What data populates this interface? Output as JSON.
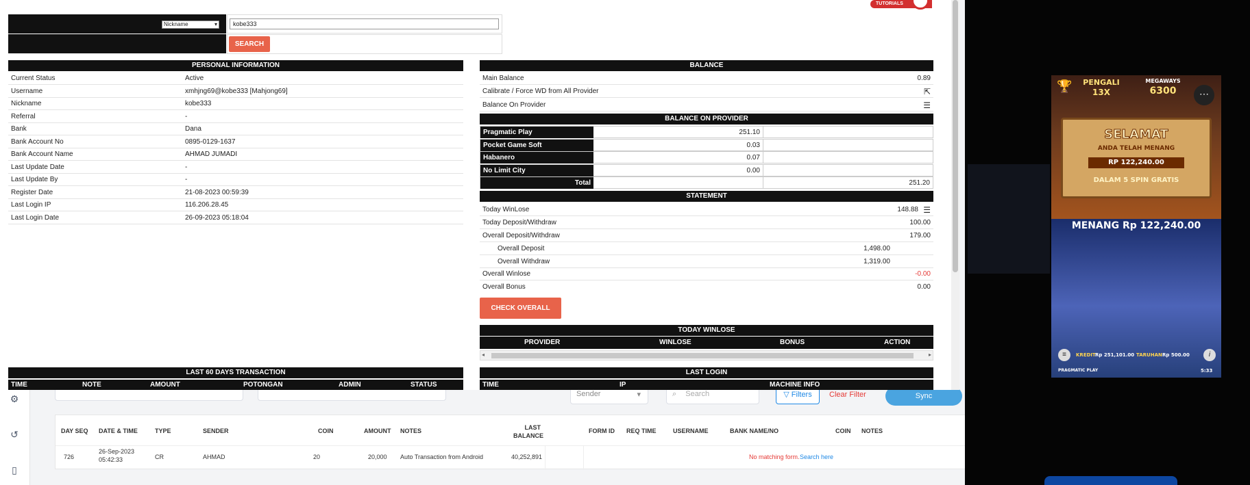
{
  "search": {
    "type_value": "Nickname",
    "query": "kobe333",
    "button": "SEARCH",
    "tutorials": "TUTORIALS"
  },
  "personal": {
    "title": "PERSONAL INFORMATION",
    "rows": [
      {
        "label": "Current Status",
        "value": "Active"
      },
      {
        "label": "Username",
        "value": "xmhjng69@kobe333  [Mahjong69]"
      },
      {
        "label": "Nickname",
        "value": "kobe333"
      },
      {
        "label": "Referral",
        "value": "-"
      },
      {
        "label": "Bank",
        "value": "Dana"
      },
      {
        "label": "Bank Account No",
        "value": "0895-0129-1637"
      },
      {
        "label": "Bank Account Name",
        "value": "AHMAD JUMADI"
      },
      {
        "label": "Last Update Date",
        "value": "-"
      },
      {
        "label": "Last Update By",
        "value": "-"
      },
      {
        "label": "Register Date",
        "value": "21-08-2023 00:59:39"
      },
      {
        "label": "Last Login IP",
        "value": "116.206.28.45"
      },
      {
        "label": "Last Login Date",
        "value": "26-09-2023 05:18:04"
      }
    ]
  },
  "balance": {
    "title": "BALANCE",
    "main_label": "Main Balance",
    "main_value": "0.89",
    "calibrate_label": "Calibrate / Force WD from All Provider",
    "provider_label": "Balance On Provider"
  },
  "balance_on_provider": {
    "title": "BALANCE ON PROVIDER",
    "providers": [
      {
        "name": "Pragmatic Play",
        "value": "251.10"
      },
      {
        "name": "Pocket Game Soft",
        "value": "0.03"
      },
      {
        "name": "Habanero",
        "value": "0.07"
      },
      {
        "name": "No Limit City",
        "value": "0.00"
      }
    ],
    "total_label": "Total",
    "total_value": "251.20"
  },
  "statement": {
    "title": "STATEMENT",
    "today_winlose_label": "Today WinLose",
    "today_winlose_value": "148.88",
    "today_dw_label": "Today Deposit/Withdraw",
    "today_dw_value": "100.00",
    "overall_dw_label": "Overall Deposit/Withdraw",
    "overall_dw_value": "179.00",
    "overall_deposit_label": "Overall Deposit",
    "overall_deposit_value": "1,498.00",
    "overall_withdraw_label": "Overall Withdraw",
    "overall_withdraw_value": "1,319.00",
    "overall_winlose_label": "Overall Winlose",
    "overall_winlose_value": "-0.00",
    "overall_bonus_label": "Overall Bonus",
    "overall_bonus_value": "0.00",
    "check_button": "CHECK OVERALL"
  },
  "today_winlose": {
    "title": "TODAY WINLOSE",
    "columns": [
      "PROVIDER",
      "WINLOSE",
      "BONUS",
      "ACTION"
    ]
  },
  "last60": {
    "title": "LAST 60 DAYS TRANSACTION",
    "columns": [
      "TIME",
      "NOTE",
      "AMOUNT",
      "POTONGAN",
      "ADMIN",
      "STATUS"
    ]
  },
  "last_login": {
    "title": "LAST LOGIN",
    "columns": [
      "TIME",
      "IP",
      "MACHINE INFO"
    ]
  },
  "bg": {
    "sender_select": "Sender",
    "search_placeholder": "Search",
    "filters": "Filters",
    "clear_filter": "Clear Filter",
    "sync": "Sync",
    "headers": [
      "DAY SEQ",
      "DATE & TIME",
      "TYPE",
      "SENDER",
      "COIN",
      "AMOUNT",
      "NOTES",
      "LAST BALANCE",
      "FORM ID",
      "REQ TIME",
      "USERNAME",
      "BANK NAME/NO",
      "COIN",
      "NOTES"
    ],
    "row": {
      "seq": "726",
      "date": "26-Sep-2023",
      "time": "05:42:33",
      "type": "CR",
      "sender": "AHMAD",
      "coin": "20",
      "amount": "20,000",
      "notes": "Auto Transaction from Android",
      "last_balance": "40,252,891",
      "no_match": "No matching form.",
      "search_here": "Search here"
    }
  },
  "game": {
    "pengali": "PENGALI",
    "mult": "13X",
    "megaways": "MEGAWAYS",
    "ways": "6300",
    "selamat": "SELAMAT",
    "anda": "ANDA TELAH MENANG",
    "amount": "RP 122,240.00",
    "spin": "DALAM 5 SPIN GRATIS",
    "menang": "MENANG Rp 122,240.00",
    "kredit_label": "KREDIT",
    "kredit": "Rp 251,101.00",
    "taruhan_label": "TARUHAN",
    "taruhan": "Rp 500.00",
    "brand": "PRAGMATIC PLAY",
    "time": "5:33"
  },
  "colors": {
    "accent": "#e8634a",
    "header_bar": "#111111",
    "negative": "#e53935",
    "link": "#1e88e5"
  }
}
